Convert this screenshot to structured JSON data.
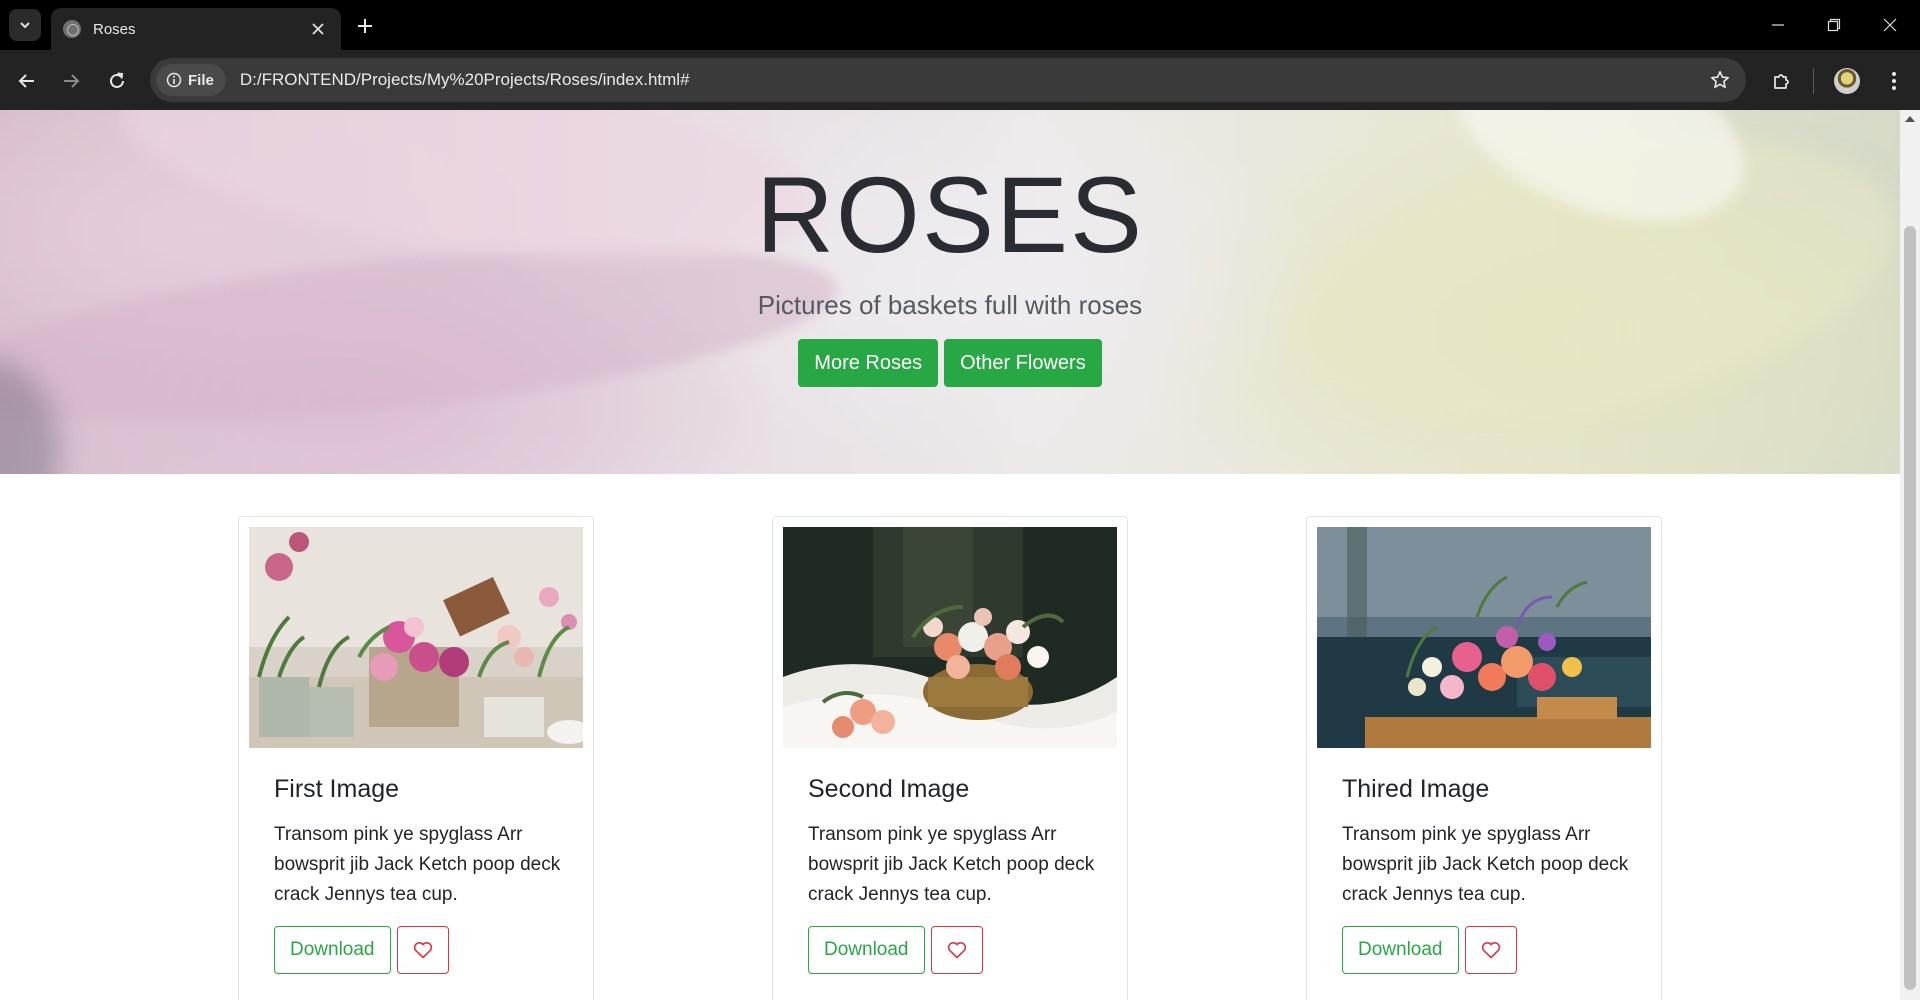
{
  "browser": {
    "tab_title": "Roses",
    "security_chip": "File",
    "url": "D:/FRONTEND/Projects/My%20Projects/Roses/index.html#"
  },
  "hero": {
    "title": "ROSES",
    "subtitle": "Pictures of baskets full with roses",
    "buttons": [
      "More Roses",
      "Other Flowers"
    ]
  },
  "cards": [
    {
      "title": "First Image",
      "text": "Transom pink ye spyglass Arr bowsprit jib Jack Ketch poop deck crack Jennys tea cup.",
      "download_label": "Download"
    },
    {
      "title": "Second Image",
      "text": "Transom pink ye spyglass Arr bowsprit jib Jack Ketch poop deck crack Jennys tea cup.",
      "download_label": "Download"
    },
    {
      "title": "Thired Image",
      "text": "Transom pink ye spyglass Arr bowsprit jib Jack Ketch poop deck crack Jennys tea cup.",
      "download_label": "Download"
    }
  ],
  "icons": {
    "tab_search": "chevron-down-icon",
    "tab_favicon": "globe-icon",
    "tab_close": "close-icon",
    "new_tab": "plus-icon",
    "minimize": "minimize-icon",
    "restore": "restore-icon",
    "close_window": "close-icon",
    "back": "arrow-left-icon",
    "forward": "arrow-right-icon",
    "reload": "reload-icon",
    "info": "info-icon",
    "bookmark": "star-icon",
    "extensions": "puzzle-icon",
    "profile": "avatar",
    "menu": "kebab-menu-icon",
    "like": "heart-icon"
  },
  "colors": {
    "primary_green": "#28a745",
    "like_red": "#dc3545",
    "chrome_dark": "#232323"
  }
}
